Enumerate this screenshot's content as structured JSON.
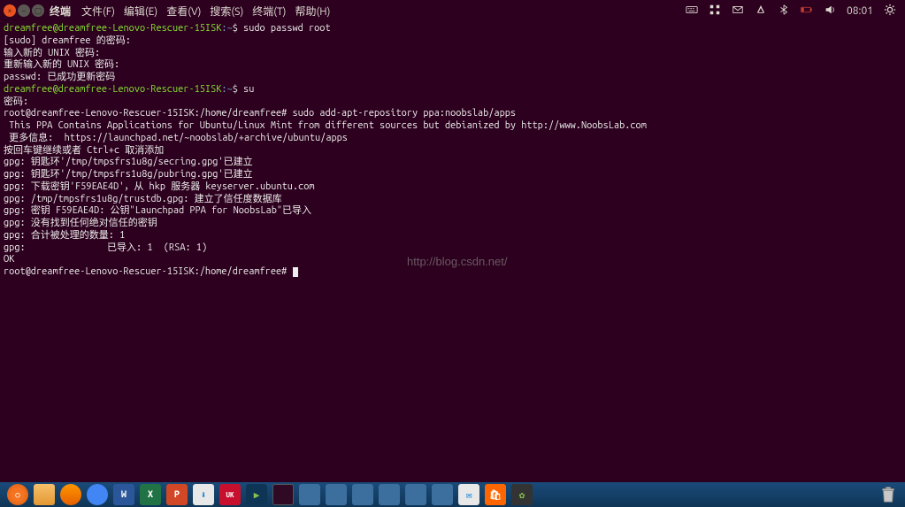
{
  "menubar": {
    "app_title": "终端",
    "items": [
      "文件(F)",
      "编辑(E)",
      "查看(V)",
      "搜索(S)",
      "终端(T)",
      "帮助(H)"
    ]
  },
  "tray": {
    "clock": "08:01"
  },
  "terminal": {
    "lines": [
      {
        "t": "prompt",
        "user": "dreamfree@dreamfree-Lenovo-Rescuer-15ISK",
        "path": ":~",
        "cmd": "$ sudo passwd root"
      },
      {
        "t": "plain",
        "text": "[sudo] dreamfree 的密码:"
      },
      {
        "t": "plain",
        "text": "输入新的 UNIX 密码:"
      },
      {
        "t": "plain",
        "text": "重新输入新的 UNIX 密码:"
      },
      {
        "t": "plain",
        "text": "passwd: 已成功更新密码"
      },
      {
        "t": "prompt",
        "user": "dreamfree@dreamfree-Lenovo-Rescuer-15ISK",
        "path": ":~",
        "cmd": "$ su"
      },
      {
        "t": "plain",
        "text": "密码:"
      },
      {
        "t": "root",
        "prompt": "root@dreamfree-Lenovo-Rescuer-15ISK:/home/dreamfree#",
        "cmd": " sudo add-apt-repository ppa:noobslab/apps"
      },
      {
        "t": "plain",
        "text": " This PPA Contains Applications for Ubuntu/Linux Mint from different sources but debianized by http://www.NoobsLab.com"
      },
      {
        "t": "plain",
        "text": " 更多信息:  https://launchpad.net/~noobslab/+archive/ubuntu/apps"
      },
      {
        "t": "plain",
        "text": "按回车键继续或者 Ctrl+c 取消添加"
      },
      {
        "t": "plain",
        "text": ""
      },
      {
        "t": "plain",
        "text": "gpg: 钥匙环'/tmp/tmpsfrs1u8g/secring.gpg'已建立"
      },
      {
        "t": "plain",
        "text": "gpg: 钥匙环'/tmp/tmpsfrs1u8g/pubring.gpg'已建立"
      },
      {
        "t": "plain",
        "text": "gpg: 下载密钥'F59EAE4D'，从 hkp 服务器 keyserver.ubuntu.com"
      },
      {
        "t": "plain",
        "text": "gpg: /tmp/tmpsfrs1u8g/trustdb.gpg: 建立了信任度数据库"
      },
      {
        "t": "plain",
        "text": "gpg: 密钥 F59EAE4D: 公钥\"Launchpad PPA for NoobsLab\"已导入"
      },
      {
        "t": "plain",
        "text": "gpg: 没有找到任何绝对信任的密钥"
      },
      {
        "t": "plain",
        "text": "gpg: 合计被处理的数量: 1"
      },
      {
        "t": "plain",
        "text": "gpg:               已导入: 1  (RSA: 1)"
      },
      {
        "t": "plain",
        "text": "OK"
      },
      {
        "t": "root-cursor",
        "prompt": "root@dreamfree-Lenovo-Rescuer-15ISK:/home/dreamfree#",
        "cmd": " "
      }
    ]
  },
  "watermark": "http://blog.csdn.net/",
  "dock": {
    "items": [
      {
        "name": "ubuntu-launcher",
        "cls": "dock-ubuntu",
        "glyph": "○"
      },
      {
        "name": "files",
        "cls": "dock-files",
        "glyph": ""
      },
      {
        "name": "firefox",
        "cls": "dock-ff",
        "glyph": ""
      },
      {
        "name": "chromium",
        "cls": "dock-chr",
        "glyph": ""
      },
      {
        "name": "word",
        "cls": "dock-word",
        "glyph": "W"
      },
      {
        "name": "excel",
        "cls": "dock-excel",
        "glyph": "X"
      },
      {
        "name": "powerpoint",
        "cls": "dock-ppt",
        "glyph": "P"
      },
      {
        "name": "software-center",
        "cls": "dock-sw",
        "glyph": "⬇"
      },
      {
        "name": "keyboard-uk",
        "cls": "dock-uk",
        "glyph": "UK"
      },
      {
        "name": "show-apps",
        "cls": "dock-arrow",
        "glyph": "▶"
      },
      {
        "name": "terminal-running",
        "cls": "dock-term",
        "glyph": ""
      },
      {
        "name": "task-1",
        "cls": "dock-task",
        "glyph": ""
      },
      {
        "name": "task-2",
        "cls": "dock-task",
        "glyph": ""
      },
      {
        "name": "task-3",
        "cls": "dock-task",
        "glyph": ""
      },
      {
        "name": "task-4",
        "cls": "dock-task",
        "glyph": ""
      },
      {
        "name": "task-5",
        "cls": "dock-task",
        "glyph": ""
      },
      {
        "name": "task-6",
        "cls": "dock-task",
        "glyph": ""
      },
      {
        "name": "mail",
        "cls": "dock-mail",
        "glyph": "✉"
      },
      {
        "name": "shop",
        "cls": "dock-shop",
        "glyph": "🛍"
      },
      {
        "name": "clover",
        "cls": "dock-clover",
        "glyph": "✿"
      }
    ]
  }
}
